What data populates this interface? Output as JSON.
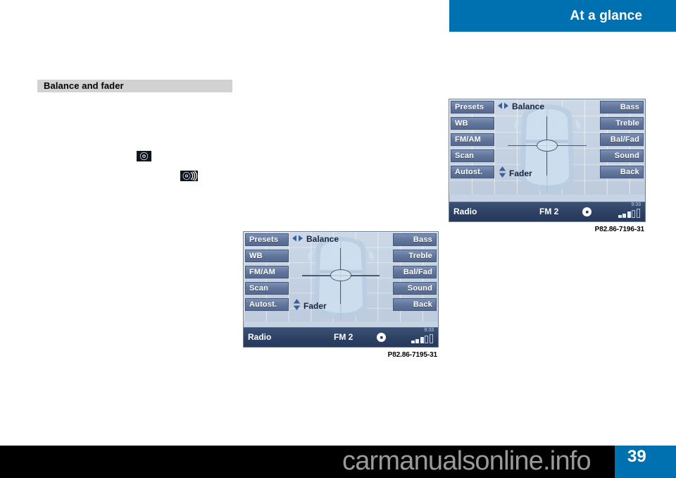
{
  "header": {
    "running_head": "At a glance",
    "banner_color": "#0071b0"
  },
  "section": {
    "title": "Balance and fader"
  },
  "symbols": [
    {
      "name": "control-knob-icon",
      "glyph": "knob"
    },
    {
      "name": "sound-waves-icon",
      "glyph": "sound"
    }
  ],
  "figures": [
    {
      "id": "figure-balance-top",
      "caption": "P82.86-7196-31",
      "display": {
        "left_keys": [
          "Presets",
          "WB",
          "FM/AM",
          "Scan",
          "Autost."
        ],
        "right_keys": [
          "Bass",
          "Treble",
          "Bal/Fad",
          "Sound",
          "Back"
        ],
        "balance_label": "Balance",
        "fader_label": "Fader",
        "status": {
          "source": "Radio",
          "band": "FM 2",
          "clock": "9:33",
          "signal_filled": 3,
          "signal_empty": 2
        }
      }
    },
    {
      "id": "figure-balance-bottom",
      "caption": "P82.86-7195-31",
      "display": {
        "left_keys": [
          "Presets",
          "WB",
          "FM/AM",
          "Scan",
          "Autost."
        ],
        "right_keys": [
          "Bass",
          "Treble",
          "Bal/Fad",
          "Sound",
          "Back"
        ],
        "balance_label": "Balance",
        "fader_label": "Fader",
        "status": {
          "source": "Radio",
          "band": "FM 2",
          "clock": "9:33",
          "signal_filled": 3,
          "signal_empty": 2
        }
      }
    }
  ],
  "footer": {
    "watermark": "carmanualsonline.info",
    "page_number": "39"
  }
}
